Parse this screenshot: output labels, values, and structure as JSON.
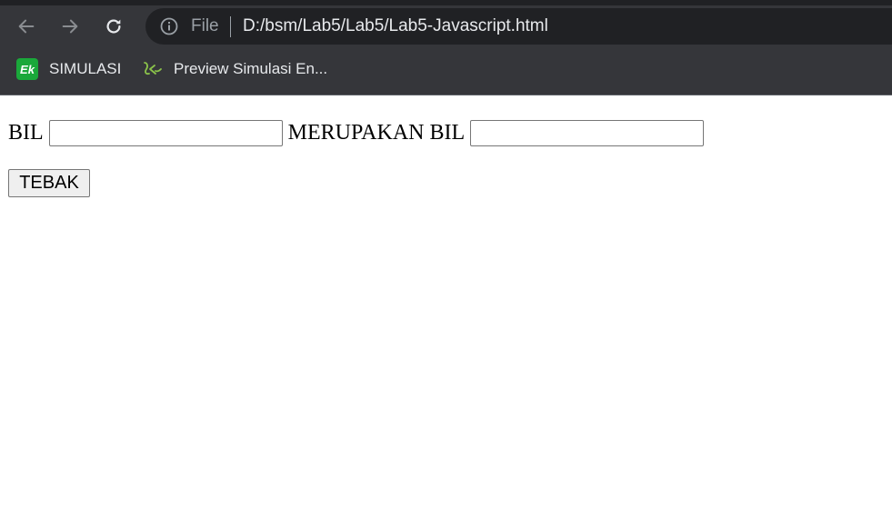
{
  "browser": {
    "back_icon": "arrow-left-icon",
    "forward_icon": "arrow-right-icon",
    "reload_icon": "reload-icon",
    "info_icon": "info-circle-icon",
    "file_chip": "File",
    "url": "D:/bsm/Lab5/Lab5/Lab5-Javascript.html",
    "bookmarks": [
      {
        "label": "SIMULASI",
        "icon": "ek-logo-icon",
        "icon_text": "Ek"
      },
      {
        "label": "Preview Simulasi En...",
        "icon": "simulasi-logo-icon"
      }
    ],
    "colors": {
      "frame": "#35363a",
      "omnibox": "#202124",
      "text": "#e8eaed",
      "muted": "#9aa0a6",
      "ek_green": "#1aa83a",
      "sim_green": "#8bc34a"
    }
  },
  "form": {
    "label_bil": "BIL",
    "input_bil_value": "",
    "label_merupakan": "MERUPAKAN BIL",
    "input_result_value": "",
    "button_label": "TEBAK"
  }
}
